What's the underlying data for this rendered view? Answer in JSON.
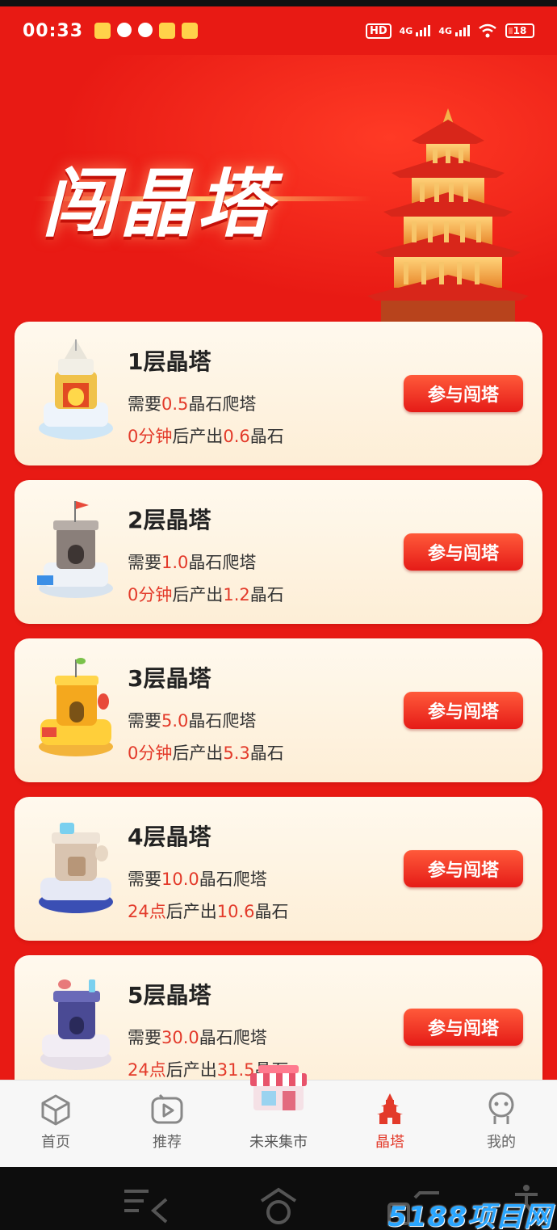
{
  "status_bar": {
    "time": "00:33",
    "hd": "HD",
    "net1": "4G",
    "net2": "4G",
    "battery": "18"
  },
  "hero": {
    "title": "闯晶塔"
  },
  "cards": [
    {
      "title": "1层晶塔",
      "need_prefix": "需要",
      "need_value": "0.5",
      "need_suffix": "晶石爬塔",
      "time_value": "0分钟",
      "out_mid": "后产出",
      "out_value": "0.6",
      "out_suffix": "晶石",
      "button": "参与闯塔"
    },
    {
      "title": "2层晶塔",
      "need_prefix": "需要",
      "need_value": "1.0",
      "need_suffix": "晶石爬塔",
      "time_value": "0分钟",
      "out_mid": "后产出",
      "out_value": "1.2",
      "out_suffix": "晶石",
      "button": "参与闯塔"
    },
    {
      "title": "3层晶塔",
      "need_prefix": "需要",
      "need_value": "5.0",
      "need_suffix": "晶石爬塔",
      "time_value": "0分钟",
      "out_mid": "后产出",
      "out_value": "5.3",
      "out_suffix": "晶石",
      "button": "参与闯塔"
    },
    {
      "title": "4层晶塔",
      "need_prefix": "需要",
      "need_value": "10.0",
      "need_suffix": "晶石爬塔",
      "time_value": "24点",
      "out_mid": "后产出",
      "out_value": "10.6",
      "out_suffix": "晶石",
      "button": "参与闯塔"
    },
    {
      "title": "5层晶塔",
      "need_prefix": "需要",
      "need_value": "30.0",
      "need_suffix": "晶石爬塔",
      "time_value": "24点",
      "out_mid": "后产出",
      "out_value": "31.5",
      "out_suffix": "晶石",
      "button": "参与闯塔"
    }
  ],
  "tabbar": {
    "items": [
      {
        "label": "首页",
        "icon": "cube-icon"
      },
      {
        "label": "推荐",
        "icon": "play-icon"
      },
      {
        "label": "未来集市",
        "icon": "market-icon"
      },
      {
        "label": "晶塔",
        "icon": "tower-icon"
      },
      {
        "label": "我的",
        "icon": "robot-face-icon"
      }
    ],
    "active_index": 3,
    "active_color": "#e33a2a"
  },
  "watermark": "5188项目网",
  "colors": {
    "background": "#e81a14",
    "highlight": "#e33a2a",
    "button": "#e51b17"
  }
}
